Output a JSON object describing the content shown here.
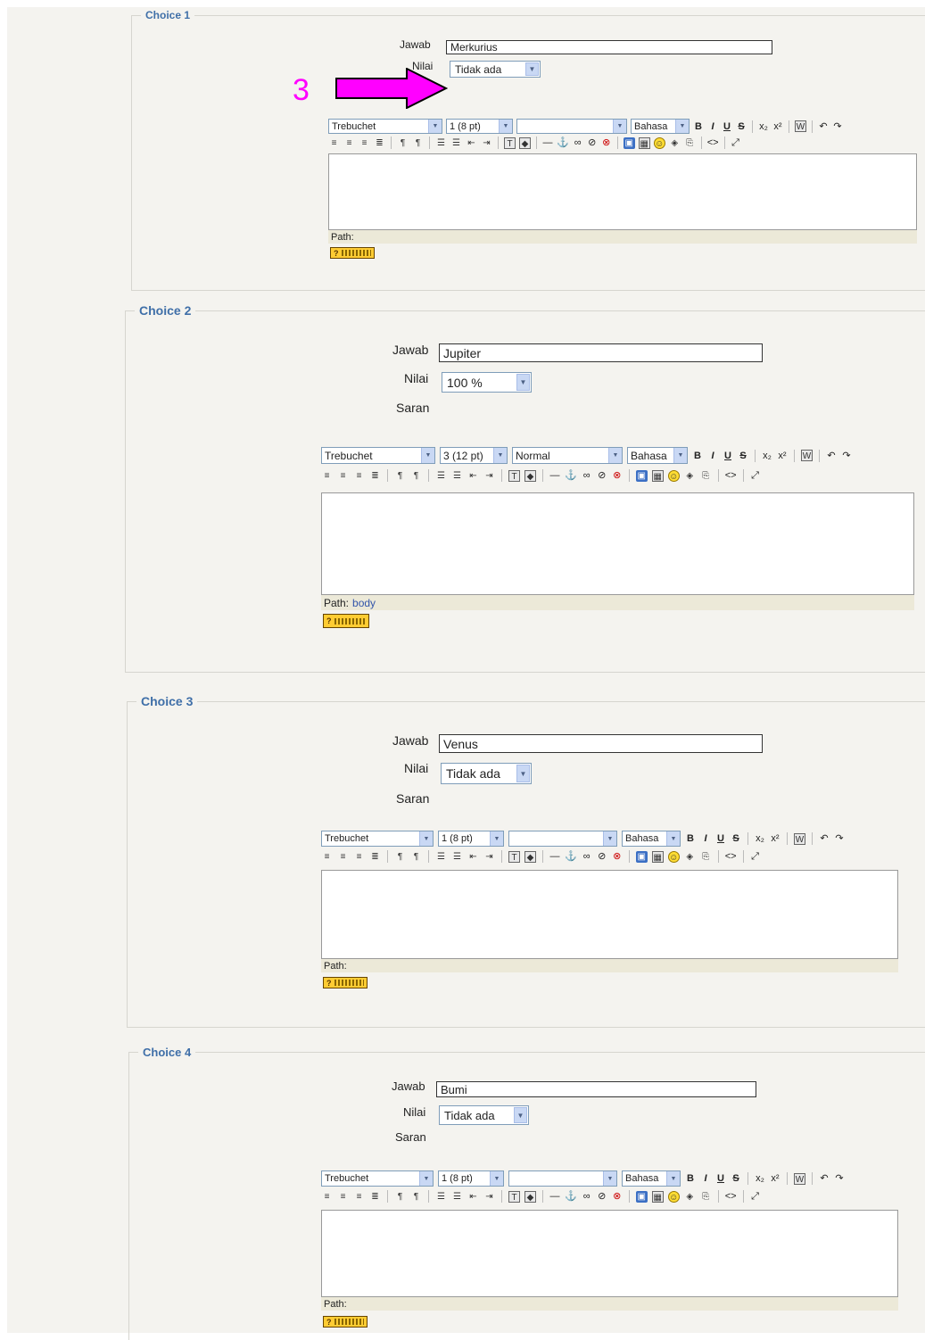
{
  "annotation": {
    "number": "3",
    "color": "#ff00ff"
  },
  "accent_color": "#3f6fa8",
  "labels": {
    "jawab": "Jawab",
    "nilai": "Nilai",
    "saran": "Saran"
  },
  "editor": {
    "block_format_default": "Normal",
    "language": "Bahasa",
    "buttons": {
      "bold": "B",
      "italic": "I",
      "underline": "U",
      "strike": "S",
      "subscript": "x₂",
      "superscript": "x²",
      "undo": "↶",
      "redo": "↷",
      "hr": "—",
      "anchor": "⚓",
      "link": "∞",
      "unlink": "⊘",
      "nolink": "⊗",
      "code": "<>",
      "fullscreen": "⤢"
    },
    "path_label": "Path:",
    "help_label": "?"
  },
  "choices": [
    {
      "legend": "Choice 1",
      "jawab": "Merkurius",
      "nilai": "Tidak ada",
      "saran": "",
      "font": "Trebuchet",
      "size": "1 (8 pt)",
      "format": "",
      "path_value": ""
    },
    {
      "legend": "Choice 2",
      "jawab": "Jupiter",
      "nilai": "100 %",
      "saran": "Saran",
      "font": "Trebuchet",
      "size": "3 (12 pt)",
      "format": "Normal",
      "path_value": "body"
    },
    {
      "legend": "Choice 3",
      "jawab": "Venus",
      "nilai": "Tidak ada",
      "saran": "Saran",
      "font": "Trebuchet",
      "size": "1 (8 pt)",
      "format": "",
      "path_value": ""
    },
    {
      "legend": "Choice 4",
      "jawab": "Bumi",
      "nilai": "Tidak ada",
      "saran": "Saran",
      "font": "Trebuchet",
      "size": "1 (8 pt)",
      "format": "",
      "path_value": ""
    }
  ]
}
